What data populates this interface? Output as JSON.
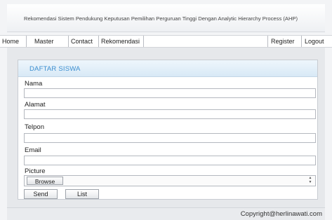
{
  "header": {
    "title": "Rekomendasi Sistem Pendukung Keputusan Pemilihan Perguruan Tinggi Dengan Analytic Hierarchy Process (AHP)"
  },
  "nav": {
    "home": "Home",
    "master": "Master",
    "contact": "Contact",
    "rekomendasi": "Rekomendasi",
    "register": "Register",
    "logout": "Logout"
  },
  "panel": {
    "title": "DAFTAR SISWA"
  },
  "form": {
    "nama_label": "Nama",
    "nama_value": "",
    "alamat_label": "Alamat",
    "alamat_value": "",
    "telpon_label": "Telpon",
    "telpon_value": "",
    "email_label": "Email",
    "email_value": "",
    "picture_label": "Picture",
    "browse_label": "Browse"
  },
  "buttons": {
    "send": "Send",
    "list": "List"
  },
  "footer": {
    "copyright": "Copyright@herlinawati.com"
  },
  "colors": {
    "panel_title": "#3b8ed0",
    "panel_header": "#d8e9f6",
    "content_bg": "#e6e8eb"
  }
}
